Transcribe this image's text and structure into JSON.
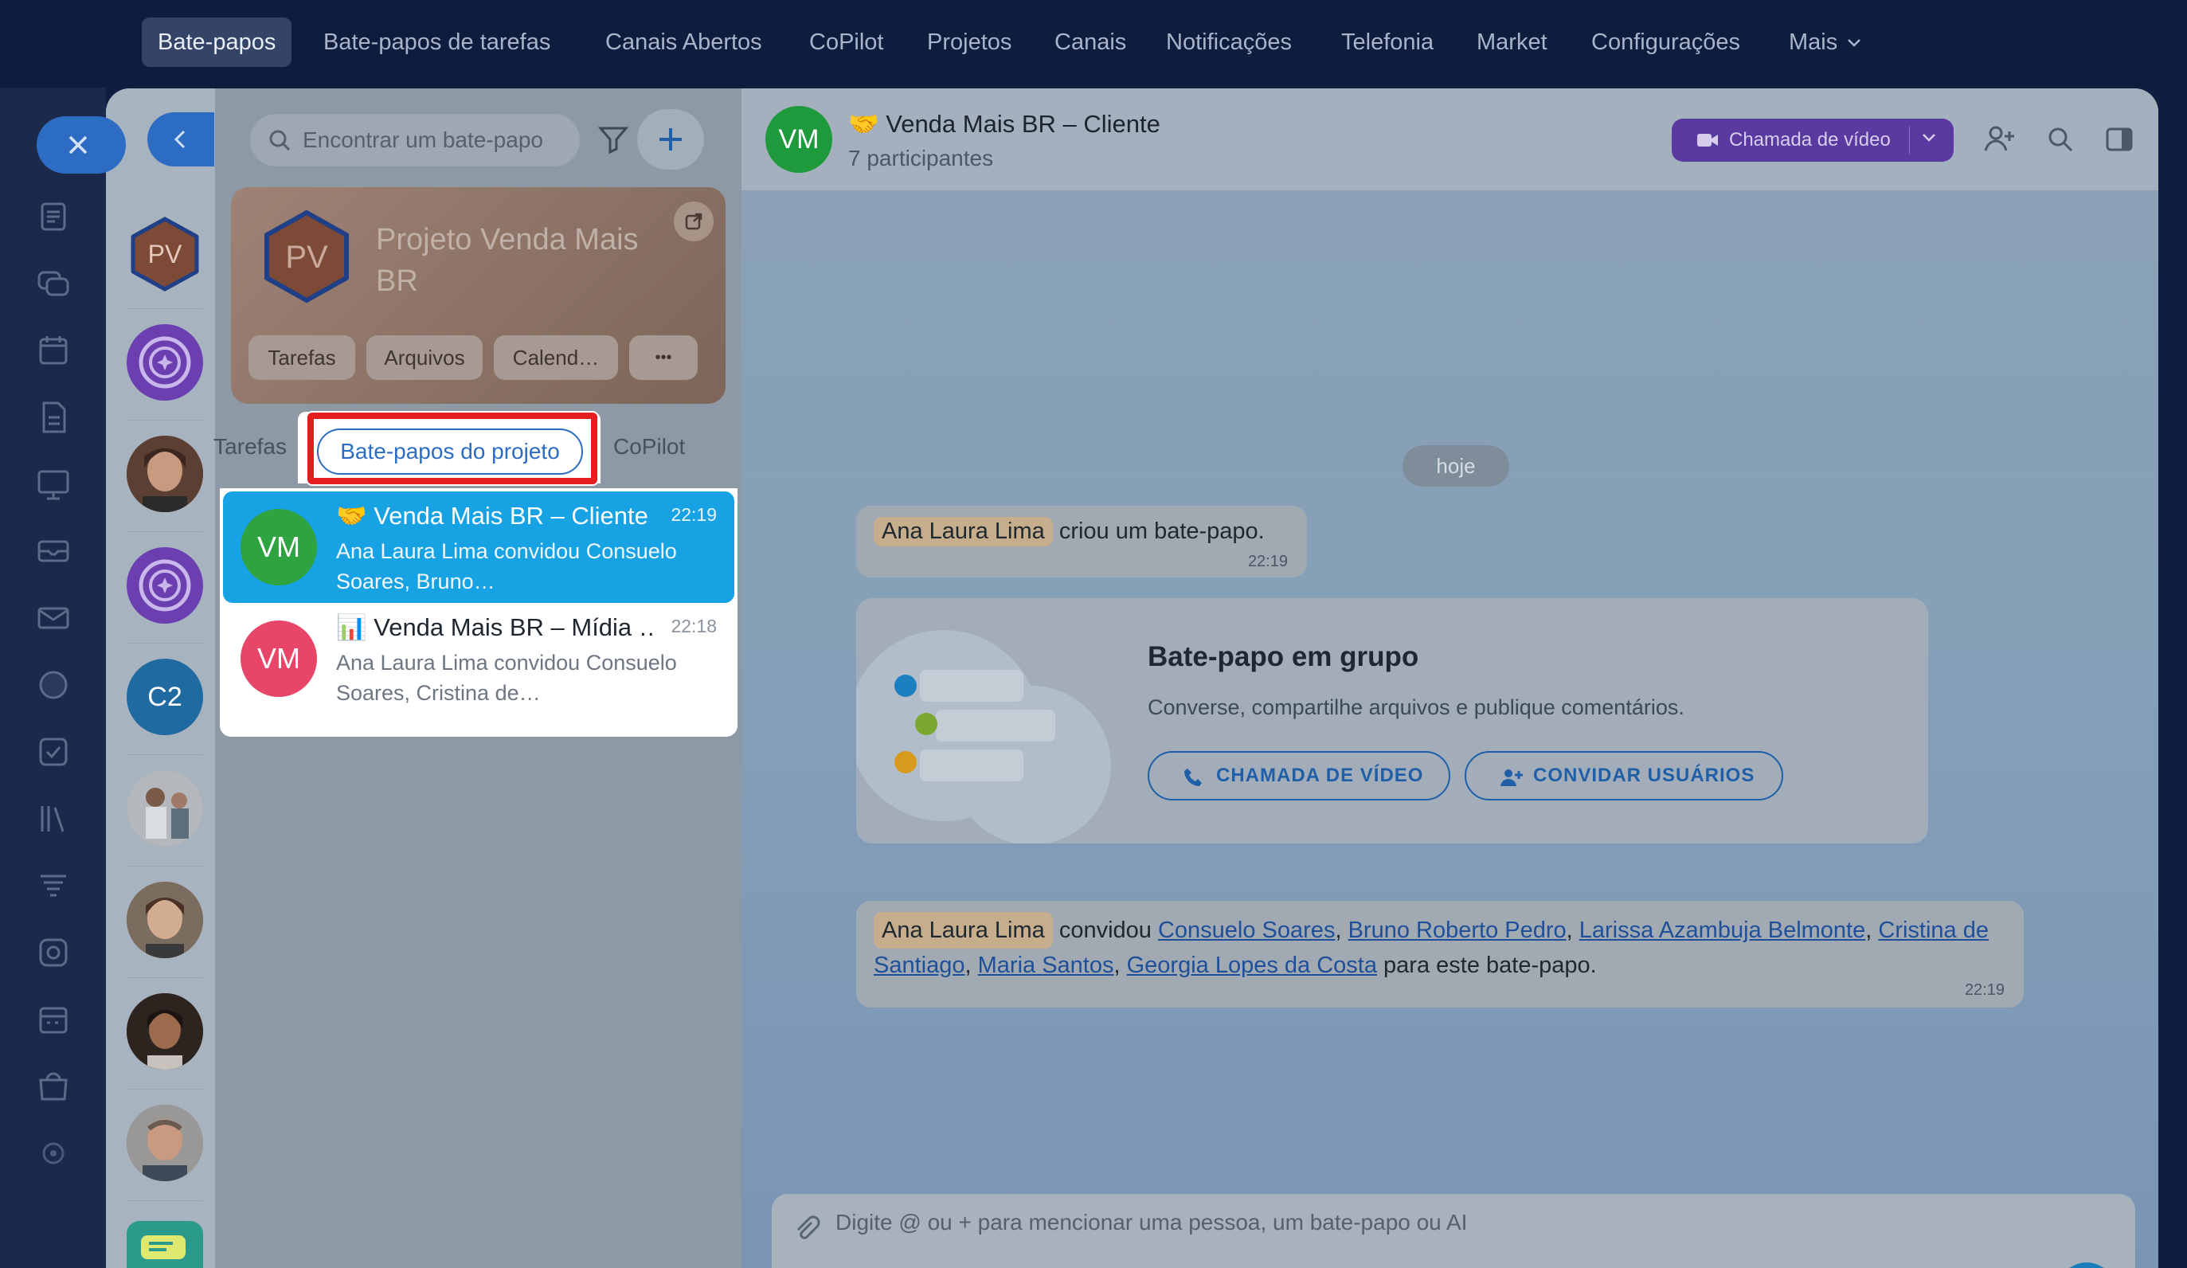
{
  "topnav": {
    "items": [
      "Bate-papos",
      "Bate-papos de tarefas",
      "Canais Abertos",
      "CoPilot",
      "Projetos",
      "Canais",
      "Notificações",
      "Telefonia",
      "Market",
      "Configurações",
      "Mais"
    ],
    "active": "Bate-papos"
  },
  "left_rail": {
    "icons": [
      "feed-icon",
      "chat-icon",
      "calendar-icon",
      "document-icon",
      "whiteboard-icon",
      "inbox-icon",
      "mail-icon",
      "projects-icon",
      "tasks-icon",
      "library-icon",
      "automation-icon",
      "sites-icon",
      "booking-icon",
      "store-icon",
      "settings-icon"
    ]
  },
  "avatars": [
    {
      "type": "project",
      "initials": "PV",
      "color": "#7c4a36"
    },
    {
      "type": "copilot",
      "initials": "",
      "color": "#6c3fb0"
    },
    {
      "type": "person",
      "initials": "",
      "color": "#6b4a3c"
    },
    {
      "type": "copilot",
      "initials": "",
      "color": "#6c3fb0"
    },
    {
      "type": "initials",
      "initials": "C2",
      "color": "#1f6aa1"
    },
    {
      "type": "person",
      "initials": "",
      "color": "#8a8f96"
    },
    {
      "type": "person",
      "initials": "",
      "color": "#7b6c60"
    },
    {
      "type": "person",
      "initials": "",
      "color": "#4f3528"
    },
    {
      "type": "person",
      "initials": "",
      "color": "#7b7a78"
    }
  ],
  "search": {
    "placeholder": "Encontrar um bate-papo"
  },
  "project": {
    "initials": "PV",
    "title": "Projeto Venda Mais BR",
    "buttons": [
      "Tarefas",
      "Arquivos",
      "Calend…",
      "•••"
    ]
  },
  "tabs": {
    "left": "Tarefas",
    "active": "Bate-papos do projeto",
    "right": "CoPilot"
  },
  "chats": [
    {
      "initials": "VM",
      "emoji": "🤝",
      "title": "Venda Mais BR – Cliente",
      "time": "22:19",
      "preview": "Ana Laura Lima convidou Consuelo Soares, Bruno…",
      "avatar_color": "#2fa33f",
      "selected": true
    },
    {
      "initials": "VM",
      "emoji": "📊",
      "title": "Venda Mais BR – Mídia …",
      "time": "22:18",
      "preview": "Ana Laura Lima convidou Consuelo Soares, Cristina de…",
      "avatar_color": "#e74668",
      "selected": false
    }
  ],
  "chat_header": {
    "initials": "VM",
    "emoji": "🤝",
    "title": "Venda Mais BR – Cliente",
    "subtitle": "7 participantes",
    "video_call": "Chamada de vídeo"
  },
  "messages": {
    "date": "hoje",
    "created": {
      "name": "Ana Laura Lima",
      "text": "criou um bate-papo.",
      "time": "22:19"
    },
    "group_card": {
      "title": "Bate-papo em grupo",
      "desc": "Converse, compartilhe arquivos e publique comentários.",
      "video_btn": "CHAMADA DE VÍDEO",
      "invite_btn": "CONVIDAR USUÁRIOS"
    },
    "invite": {
      "name": "Ana Laura Lima",
      "verb": "convidou",
      "users": [
        "Consuelo Soares",
        "Bruno Roberto Pedro",
        "Larissa Azambuja Belmonte",
        "Cristina de Santiago",
        "Maria Santos",
        "Georgia Lopes da Costa"
      ],
      "suffix": "para este bate-papo.",
      "time": "22:19"
    }
  },
  "composer": {
    "placeholder": "Digite @ ou + para mencionar uma pessoa, um bate-papo ou AI"
  },
  "colors": {
    "accent": "#2d6cc3",
    "selected_chat": "#17a2e4",
    "highlight_box": "#e41e1e",
    "video_call": "#5a3aa0"
  }
}
